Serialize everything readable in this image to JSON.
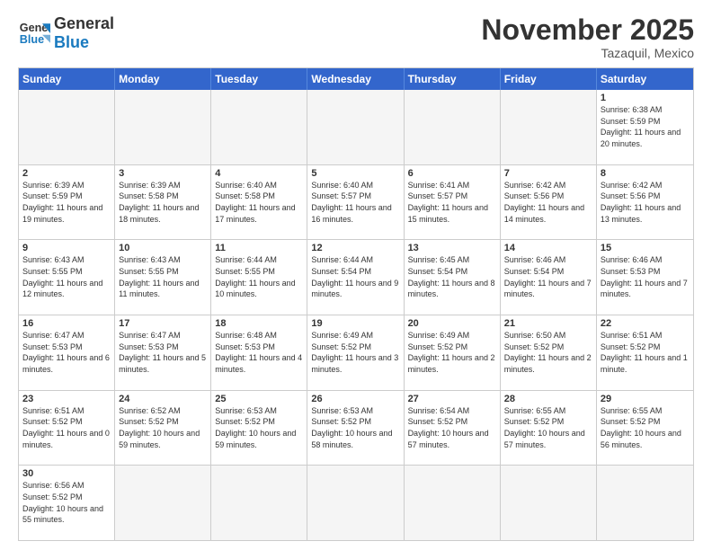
{
  "logo": {
    "line1": "General",
    "line2": "Blue"
  },
  "title": "November 2025",
  "location": "Tazaquil, Mexico",
  "header": {
    "days": [
      "Sunday",
      "Monday",
      "Tuesday",
      "Wednesday",
      "Thursday",
      "Friday",
      "Saturday"
    ]
  },
  "weeks": [
    [
      {
        "day": "",
        "info": ""
      },
      {
        "day": "",
        "info": ""
      },
      {
        "day": "",
        "info": ""
      },
      {
        "day": "",
        "info": ""
      },
      {
        "day": "",
        "info": ""
      },
      {
        "day": "",
        "info": ""
      },
      {
        "day": "1",
        "info": "Sunrise: 6:38 AM\nSunset: 5:59 PM\nDaylight: 11 hours and 20 minutes."
      }
    ],
    [
      {
        "day": "2",
        "info": "Sunrise: 6:39 AM\nSunset: 5:59 PM\nDaylight: 11 hours and 19 minutes."
      },
      {
        "day": "3",
        "info": "Sunrise: 6:39 AM\nSunset: 5:58 PM\nDaylight: 11 hours and 18 minutes."
      },
      {
        "day": "4",
        "info": "Sunrise: 6:40 AM\nSunset: 5:58 PM\nDaylight: 11 hours and 17 minutes."
      },
      {
        "day": "5",
        "info": "Sunrise: 6:40 AM\nSunset: 5:57 PM\nDaylight: 11 hours and 16 minutes."
      },
      {
        "day": "6",
        "info": "Sunrise: 6:41 AM\nSunset: 5:57 PM\nDaylight: 11 hours and 15 minutes."
      },
      {
        "day": "7",
        "info": "Sunrise: 6:42 AM\nSunset: 5:56 PM\nDaylight: 11 hours and 14 minutes."
      },
      {
        "day": "8",
        "info": "Sunrise: 6:42 AM\nSunset: 5:56 PM\nDaylight: 11 hours and 13 minutes."
      }
    ],
    [
      {
        "day": "9",
        "info": "Sunrise: 6:43 AM\nSunset: 5:55 PM\nDaylight: 11 hours and 12 minutes."
      },
      {
        "day": "10",
        "info": "Sunrise: 6:43 AM\nSunset: 5:55 PM\nDaylight: 11 hours and 11 minutes."
      },
      {
        "day": "11",
        "info": "Sunrise: 6:44 AM\nSunset: 5:55 PM\nDaylight: 11 hours and 10 minutes."
      },
      {
        "day": "12",
        "info": "Sunrise: 6:44 AM\nSunset: 5:54 PM\nDaylight: 11 hours and 9 minutes."
      },
      {
        "day": "13",
        "info": "Sunrise: 6:45 AM\nSunset: 5:54 PM\nDaylight: 11 hours and 8 minutes."
      },
      {
        "day": "14",
        "info": "Sunrise: 6:46 AM\nSunset: 5:54 PM\nDaylight: 11 hours and 7 minutes."
      },
      {
        "day": "15",
        "info": "Sunrise: 6:46 AM\nSunset: 5:53 PM\nDaylight: 11 hours and 7 minutes."
      }
    ],
    [
      {
        "day": "16",
        "info": "Sunrise: 6:47 AM\nSunset: 5:53 PM\nDaylight: 11 hours and 6 minutes."
      },
      {
        "day": "17",
        "info": "Sunrise: 6:47 AM\nSunset: 5:53 PM\nDaylight: 11 hours and 5 minutes."
      },
      {
        "day": "18",
        "info": "Sunrise: 6:48 AM\nSunset: 5:53 PM\nDaylight: 11 hours and 4 minutes."
      },
      {
        "day": "19",
        "info": "Sunrise: 6:49 AM\nSunset: 5:52 PM\nDaylight: 11 hours and 3 minutes."
      },
      {
        "day": "20",
        "info": "Sunrise: 6:49 AM\nSunset: 5:52 PM\nDaylight: 11 hours and 2 minutes."
      },
      {
        "day": "21",
        "info": "Sunrise: 6:50 AM\nSunset: 5:52 PM\nDaylight: 11 hours and 2 minutes."
      },
      {
        "day": "22",
        "info": "Sunrise: 6:51 AM\nSunset: 5:52 PM\nDaylight: 11 hours and 1 minute."
      }
    ],
    [
      {
        "day": "23",
        "info": "Sunrise: 6:51 AM\nSunset: 5:52 PM\nDaylight: 11 hours and 0 minutes."
      },
      {
        "day": "24",
        "info": "Sunrise: 6:52 AM\nSunset: 5:52 PM\nDaylight: 10 hours and 59 minutes."
      },
      {
        "day": "25",
        "info": "Sunrise: 6:53 AM\nSunset: 5:52 PM\nDaylight: 10 hours and 59 minutes."
      },
      {
        "day": "26",
        "info": "Sunrise: 6:53 AM\nSunset: 5:52 PM\nDaylight: 10 hours and 58 minutes."
      },
      {
        "day": "27",
        "info": "Sunrise: 6:54 AM\nSunset: 5:52 PM\nDaylight: 10 hours and 57 minutes."
      },
      {
        "day": "28",
        "info": "Sunrise: 6:55 AM\nSunset: 5:52 PM\nDaylight: 10 hours and 57 minutes."
      },
      {
        "day": "29",
        "info": "Sunrise: 6:55 AM\nSunset: 5:52 PM\nDaylight: 10 hours and 56 minutes."
      }
    ],
    [
      {
        "day": "30",
        "info": "Sunrise: 6:56 AM\nSunset: 5:52 PM\nDaylight: 10 hours and 55 minutes."
      },
      {
        "day": "",
        "info": ""
      },
      {
        "day": "",
        "info": ""
      },
      {
        "day": "",
        "info": ""
      },
      {
        "day": "",
        "info": ""
      },
      {
        "day": "",
        "info": ""
      },
      {
        "day": "",
        "info": ""
      }
    ]
  ]
}
